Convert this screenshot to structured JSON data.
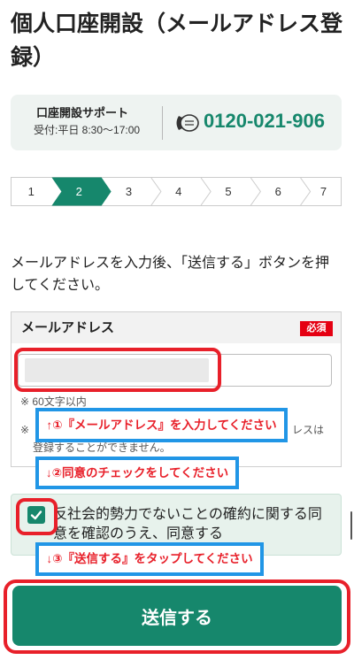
{
  "colors": {
    "brand": "#16876c",
    "annotation_red": "#e8202a",
    "annotation_blue": "#2196e6",
    "required_red": "#e50012"
  },
  "page": {
    "title": "個人口座開設（メールアドレス登録）"
  },
  "support": {
    "label": "口座開設サポート",
    "hours": "受付:平日 8:30〜17:00",
    "phone": "0120-021-906",
    "icon": "free-dial-icon"
  },
  "steps": {
    "items": [
      "1",
      "2",
      "3",
      "4",
      "5",
      "6",
      "7"
    ],
    "current": 2
  },
  "instruction": "メールアドレスを入力後、「送信する」ボタンを押してください。",
  "email_form": {
    "label": "メールアドレス",
    "required_badge": "必須",
    "notes": {
      "length_limit": "※ 60文字以内",
      "restriction_mark": "※",
      "restriction_fragment": "レスは",
      "restriction_line2": "登録することができません。"
    }
  },
  "consent": {
    "text": "反社会的勢力でないことの確約に関する同意を確認のうえ、同意する",
    "checked": true
  },
  "submit": {
    "label": "送信する"
  },
  "annotations": {
    "callouts": [
      "↑①『メールアドレス』を入力してください",
      "↓②同意のチェックをしてください",
      "↓③『送信する』をタップしてください"
    ]
  }
}
